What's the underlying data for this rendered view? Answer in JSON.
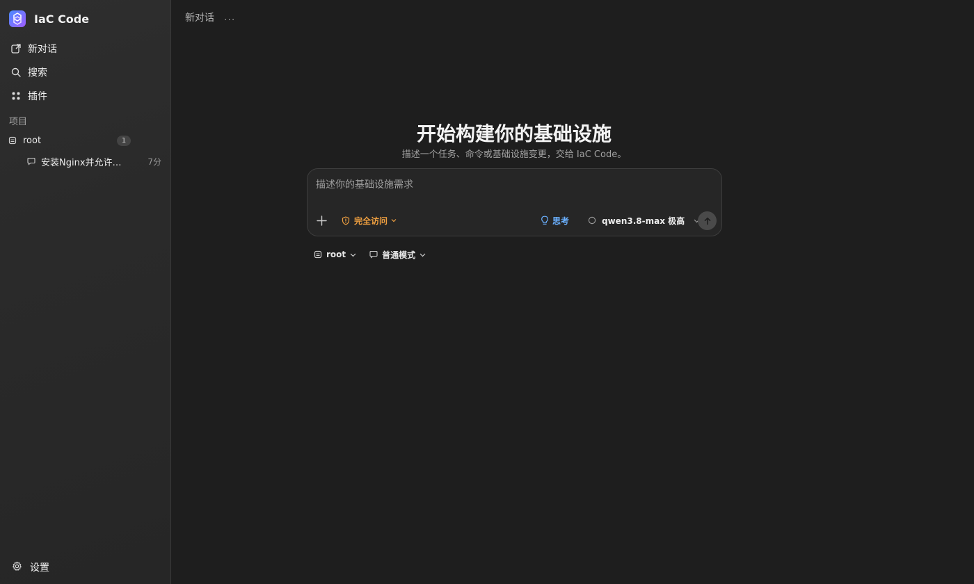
{
  "app": {
    "name": "IaC Code"
  },
  "sidebar": {
    "nav": [
      {
        "label": "新对话",
        "icon": "new-chat-icon"
      },
      {
        "label": "搜索",
        "icon": "search-icon"
      },
      {
        "label": "插件",
        "icon": "plugin-icon"
      }
    ],
    "section_title": "项目",
    "projects": [
      {
        "name": "root",
        "count": "1",
        "conversations": [
          {
            "title": "安装Nginx并允许公网访问",
            "time": "7分"
          }
        ]
      }
    ],
    "settings_label": "设置"
  },
  "topbar": {
    "title": "新对话",
    "more": "..."
  },
  "main": {
    "title": "开始构建你的基础设施",
    "subtitle": "描述一个任务、命令或基础设施变更，交给 IaC Code。",
    "composer": {
      "placeholder": "描述你的基础设施需求",
      "value": "",
      "access_label": "完全访问",
      "think_label": "思考",
      "model_label": "qwen3.8-max 极高"
    },
    "project_select": "root",
    "mode_select": "普通模式"
  },
  "colors": {
    "background": "#1e1e1e",
    "sidebar": "#2a2a2a",
    "access_accent": "#f0a040",
    "think_accent": "#6ab0ff"
  }
}
